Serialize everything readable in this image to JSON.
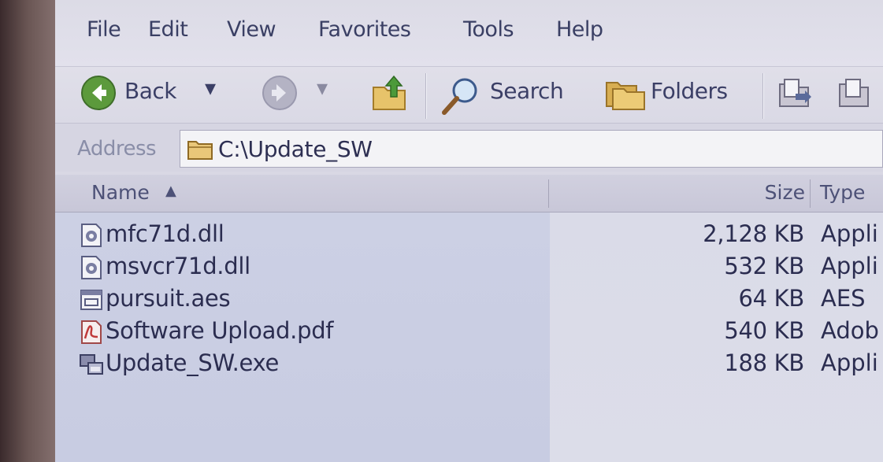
{
  "menu": {
    "items": [
      {
        "label": "File"
      },
      {
        "label": "Edit"
      },
      {
        "label": "View"
      },
      {
        "label": "Favorites"
      },
      {
        "label": "Tools"
      },
      {
        "label": "Help"
      }
    ]
  },
  "toolbar": {
    "back_label": "Back",
    "search_label": "Search",
    "folders_label": "Folders"
  },
  "address": {
    "label": "Address",
    "value": "C:\\Update_SW"
  },
  "columns": {
    "name": "Name",
    "size": "Size",
    "type": "Type"
  },
  "files": [
    {
      "name": "mfc71d.dll",
      "size": "2,128 KB",
      "type": "Appli",
      "icon": "dll-file-icon"
    },
    {
      "name": "msvcr71d.dll",
      "size": "532 KB",
      "type": "Appli",
      "icon": "dll-file-icon"
    },
    {
      "name": "pursuit.aes",
      "size": "64 KB",
      "type": "AES",
      "icon": "generic-file-icon"
    },
    {
      "name": "Software Upload.pdf",
      "size": "540 KB",
      "type": "Adob",
      "icon": "pdf-file-icon"
    },
    {
      "name": "Update_SW.exe",
      "size": "188 KB",
      "type": "Appli",
      "icon": "exe-file-icon"
    }
  ],
  "colors": {
    "window_bg": "#d9d8e4",
    "text": "#2b2d50",
    "back_button": "#5c9a3c"
  }
}
